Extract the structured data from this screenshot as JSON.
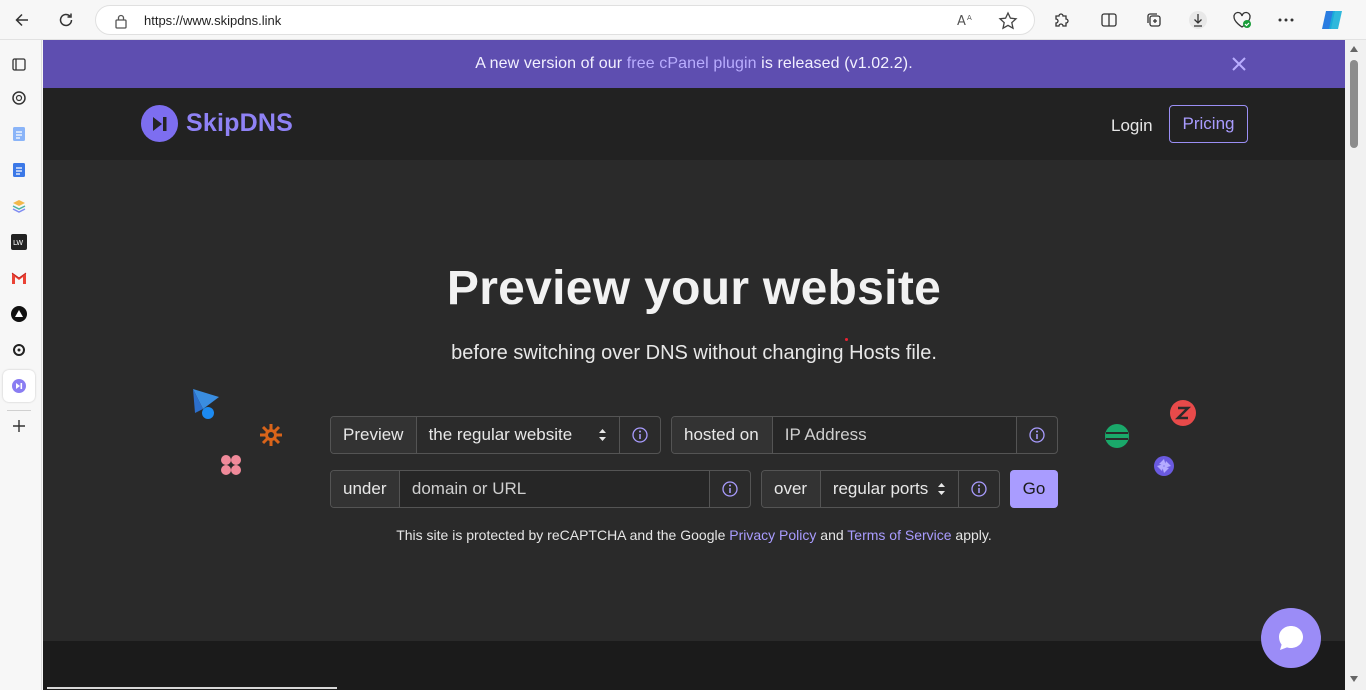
{
  "browser": {
    "url": "https://www.skipdns.link"
  },
  "banner": {
    "prefix": "A new version of our ",
    "link": "free cPanel plugin",
    "suffix": " is released (v1.02.2)."
  },
  "nav": {
    "brand": "SkipDNS",
    "login": "Login",
    "pricing": "Pricing"
  },
  "hero": {
    "title": "Preview your website",
    "subtitle": "before switching over DNS without changing Hosts file."
  },
  "form": {
    "preview_label": "Preview",
    "preview_value": "the regular website",
    "hosted_label": "hosted on",
    "ip_placeholder": "IP Address",
    "under_label": "under",
    "domain_placeholder": "domain or URL",
    "over_label": "over",
    "ports_value": "regular ports",
    "go": "Go"
  },
  "legal": {
    "prefix": "This site is protected by reCAPTCHA and the Google ",
    "privacy": "Privacy Policy",
    "and": " and ",
    "terms": "Terms of Service",
    "suffix": " apply."
  },
  "colors": {
    "accent": "#a99cff",
    "banner": "#5e4eb0",
    "background": "#2a2a2a"
  }
}
